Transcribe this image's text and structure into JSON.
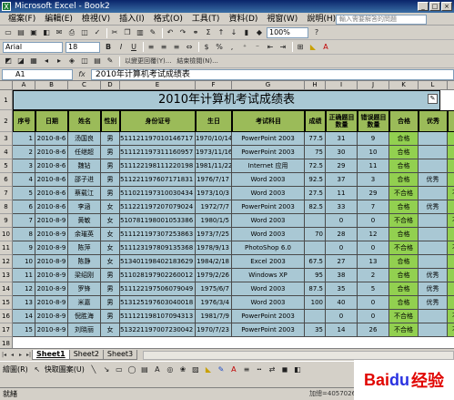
{
  "window": {
    "title": "Microsoft Excel - Book2",
    "app_icon": "excel-icon",
    "min": "_",
    "max": "□",
    "close": "×"
  },
  "menu": [
    "檔案(F)",
    "編輯(E)",
    "檢視(V)",
    "插入(I)",
    "格式(O)",
    "工具(T)",
    "資料(D)",
    "視窗(W)",
    "說明(H)"
  ],
  "help_placeholder": "輸入需要解答的問題",
  "toolbar": {
    "zoom": "100%",
    "font": "Arial",
    "size": "18",
    "toolbar3_labels": [
      "以變更回覆(Y)...",
      "結束檢閱(N)..."
    ]
  },
  "formula": {
    "namebox": "A1",
    "fx": "fx",
    "content": "2010年计算机考试成绩表"
  },
  "columns": [
    "A",
    "B",
    "C",
    "D",
    "E",
    "F",
    "G",
    "H",
    "I",
    "J",
    "K",
    "L",
    "M"
  ],
  "sheet_title": "2010年计算机考试成绩表",
  "headers": [
    "序号",
    "日期",
    "姓名",
    "性别",
    "身份证号",
    "生日",
    "考试科目",
    "成绩",
    "正确题目数量",
    "错误题目数量",
    "合格",
    "优秀",
    "合格"
  ],
  "rows": [
    [
      "1",
      "2010-8-6",
      "汤国良",
      "男",
      "511121197010146717",
      "1970/10/14",
      "PowerPoint 2003",
      "77.5",
      "31",
      "9",
      "合格",
      "",
      "合格"
    ],
    [
      "2",
      "2010-8-6",
      "任继超",
      "男",
      "511121197311160957",
      "1973/11/16",
      "PowerPoint 2003",
      "75",
      "30",
      "10",
      "合格",
      "",
      "合格"
    ],
    [
      "3",
      "2010-8-6",
      "魏钻",
      "男",
      "511122198111220198",
      "1981/11/22",
      "Internet 应用",
      "72.5",
      "29",
      "11",
      "合格",
      "",
      "合格"
    ],
    [
      "4",
      "2010-8-6",
      "邵子进",
      "男",
      "511221197607171831",
      "1976/7/17",
      "Word 2003",
      "92.5",
      "37",
      "3",
      "合格",
      "优秀",
      "合格"
    ],
    [
      "5",
      "2010-8-6",
      "蔡载江",
      "男",
      "511021197310030434",
      "1973/10/3",
      "Word 2003",
      "27.5",
      "11",
      "29",
      "不合格",
      "",
      "不合格"
    ],
    [
      "6",
      "2010-8-6",
      "李涵",
      "女",
      "511221197207079024",
      "1972/7/7",
      "PowerPoint 2003",
      "82.5",
      "33",
      "7",
      "合格",
      "优秀",
      "合格"
    ],
    [
      "7",
      "2010-8-9",
      "黄敏",
      "女",
      "510781198001053386",
      "1980/1/5",
      "Word 2003",
      "",
      "0",
      "0",
      "不合格",
      "",
      "不合格"
    ],
    [
      "8",
      "2010-8-9",
      "余璀英",
      "女",
      "511121197307253863",
      "1973/7/25",
      "Word 2003",
      "70",
      "28",
      "12",
      "合格",
      "",
      "合格"
    ],
    [
      "9",
      "2010-8-9",
      "陈萍",
      "女",
      "511123197809135368",
      "1978/9/13",
      "PhotoShop 6.0",
      "",
      "0",
      "0",
      "不合格",
      "",
      "不合格"
    ],
    [
      "10",
      "2010-8-9",
      "陈静",
      "女",
      "513401198402183629",
      "1984/2/18",
      "Excel 2003",
      "67.5",
      "27",
      "13",
      "合格",
      "",
      "合格"
    ],
    [
      "11",
      "2010-8-9",
      "梁绍刚",
      "男",
      "511028197902260012",
      "1979/2/26",
      "Windows XP",
      "95",
      "38",
      "2",
      "合格",
      "优秀",
      "合格"
    ],
    [
      "12",
      "2010-8-9",
      "罗锋",
      "男",
      "511122197506079049",
      "1975/6/7",
      "Word 2003",
      "87.5",
      "35",
      "5",
      "合格",
      "优秀",
      "合格"
    ],
    [
      "13",
      "2010-8-9",
      "米嘉",
      "男",
      "513125197603040018",
      "1976/3/4",
      "Word 2003",
      "100",
      "40",
      "0",
      "合格",
      "优秀",
      "合格"
    ],
    [
      "14",
      "2010-8-9",
      "倪胜海",
      "男",
      "511121198107094313",
      "1981/7/9",
      "PowerPoint 2003",
      "",
      "0",
      "0",
      "不合格",
      "",
      "不合格"
    ],
    [
      "15",
      "2010-8-9",
      "刘晓丽",
      "女",
      "513221197007230042",
      "1970/7/23",
      "PowerPoint 2003",
      "35",
      "14",
      "26",
      "不合格",
      "",
      "不合格"
    ]
  ],
  "sheets": [
    "Sheet1",
    "Sheet2",
    "Sheet3"
  ],
  "drawbar": {
    "draw_label": "繪圖(R)",
    "shapes_label": "快取圖案(U)"
  },
  "status": {
    "ready": "就緒",
    "sum": "加總=4057026"
  },
  "watermark": {
    "bai": "Bai",
    "du": "du",
    "jy": "经验"
  }
}
